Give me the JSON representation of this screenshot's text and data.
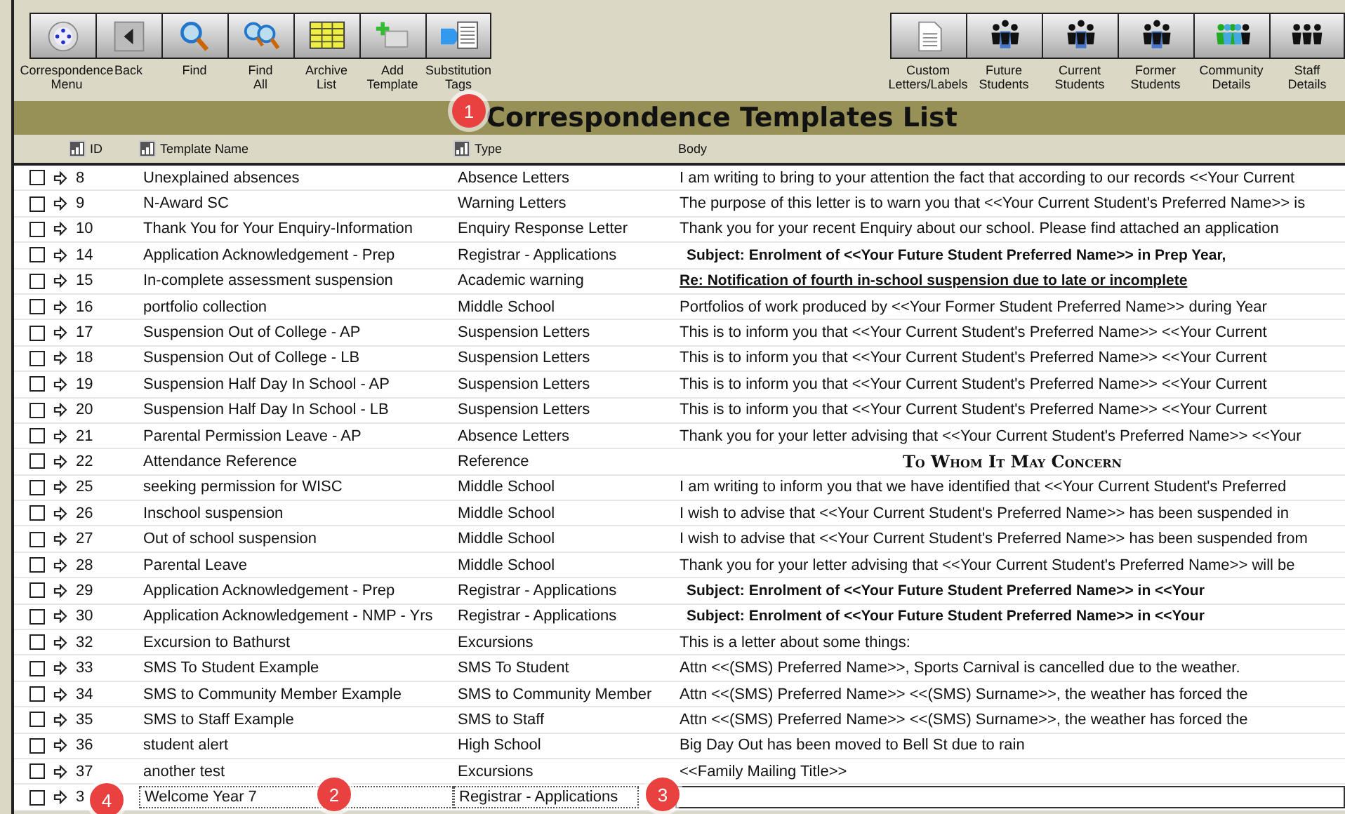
{
  "toolbar_left": [
    {
      "label": "Correspondence\nMenu"
    },
    {
      "label": "Back"
    },
    {
      "label": "Find"
    },
    {
      "label": "Find\nAll"
    },
    {
      "label": "Archive\nList"
    },
    {
      "label": "Add\nTemplate"
    },
    {
      "label": "Substitution\nTags"
    }
  ],
  "toolbar_right": [
    {
      "label": "Custom\nLetters/Labels"
    },
    {
      "label": "Future\nStudents"
    },
    {
      "label": "Current\nStudents"
    },
    {
      "label": "Former\nStudents"
    },
    {
      "label": "Community\nDetails"
    },
    {
      "label": "Staff\nDetails"
    }
  ],
  "title": "Correspondence Templates List",
  "table": {
    "columns": [
      {
        "label": "ID",
        "sortable": true
      },
      {
        "label": "Template Name",
        "sortable": true
      },
      {
        "label": "Type",
        "sortable": true
      },
      {
        "label": "Body",
        "sortable": false
      }
    ],
    "rows": [
      {
        "checked": false,
        "id": "8",
        "name": "Unexplained absences",
        "type": "Absence Letters",
        "body": "I am writing to bring to your attention the fact that according to our records <<Your Current",
        "kind": "plain"
      },
      {
        "checked": false,
        "id": "9",
        "name": "N-Award SC",
        "type": "Warning Letters",
        "body": "The purpose of this letter is to warn you that <<Your Current Student's Preferred Name>> is",
        "kind": "plain"
      },
      {
        "checked": false,
        "id": "10",
        "name": "Thank You for Your Enquiry-Information",
        "type": "Enquiry Response Letter",
        "body": "Thank you for your recent Enquiry about our school.  Please find attached an application",
        "kind": "plain"
      },
      {
        "checked": false,
        "id": "14",
        "name": "Application Acknowledgement - Prep",
        "type": "Registrar - Applications",
        "body": "Subject:  Enrolment of <<Your Future Student Preferred Name>> in Prep Year,",
        "kind": "bold"
      },
      {
        "checked": false,
        "id": "15",
        "name": "In-complete assessment suspension",
        "type": "Academic warning",
        "body": "Re: Notification of fourth in-school suspension due to late or incomplete",
        "kind": "underline"
      },
      {
        "checked": false,
        "id": "16",
        "name": "portfolio collection",
        "type": "Middle School",
        "body": "Portfolios of work produced by <<Your Former Student Preferred Name>> during Year",
        "kind": "plain"
      },
      {
        "checked": false,
        "id": "17",
        "name": "Suspension Out of College - AP",
        "type": "Suspension Letters",
        "body": "This is to inform you that <<Your Current Student's Preferred Name>> <<Your Current",
        "kind": "plain"
      },
      {
        "checked": false,
        "id": "18",
        "name": "Suspension Out of College - LB",
        "type": "Suspension Letters",
        "body": "This is to inform you that <<Your Current Student's Preferred Name>> <<Your Current",
        "kind": "plain"
      },
      {
        "checked": false,
        "id": "19",
        "name": "Suspension Half Day In School - AP",
        "type": "Suspension Letters",
        "body": "This is to inform you that <<Your Current Student's Preferred Name>> <<Your Current",
        "kind": "plain"
      },
      {
        "checked": false,
        "id": "20",
        "name": "Suspension Half Day In School - LB",
        "type": "Suspension Letters",
        "body": "This is to inform you that <<Your Current Student's Preferred Name>> <<Your Current",
        "kind": "plain"
      },
      {
        "checked": false,
        "id": "21",
        "name": "Parental Permission Leave - AP",
        "type": "Absence Letters",
        "body": "Thank you for your letter advising that <<Your Current Student's Preferred Name>> <<Your",
        "kind": "plain"
      },
      {
        "checked": false,
        "id": "22",
        "name": "Attendance Reference",
        "type": "Reference",
        "body": "To Whom It May Concern",
        "kind": "smallcaps"
      },
      {
        "checked": false,
        "id": "25",
        "name": "seeking permission for WISC",
        "type": "Middle School",
        "body": "I am writing to inform you that we have identified that <<Your Current Student's Preferred",
        "kind": "plain"
      },
      {
        "checked": false,
        "id": "26",
        "name": "Inschool suspension",
        "type": "Middle School",
        "body": "I wish to advise that <<Your Current Student's Preferred Name>> has been suspended in",
        "kind": "plain"
      },
      {
        "checked": false,
        "id": "27",
        "name": "Out of school suspension",
        "type": "Middle School",
        "body": "I wish to advise that <<Your Current Student's Preferred Name>> has been suspended from",
        "kind": "plain"
      },
      {
        "checked": false,
        "id": "28",
        "name": "Parental Leave",
        "type": "Middle School",
        "body": "Thank you for your letter advising that <<Your Current Student's Preferred Name>> will be",
        "kind": "plain"
      },
      {
        "checked": false,
        "id": "29",
        "name": "Application Acknowledgement - Prep",
        "type": "Registrar - Applications",
        "body": "Subject:  Enrolment of <<Your Future Student Preferred Name>> in <<Your",
        "kind": "bold"
      },
      {
        "checked": false,
        "id": "30",
        "name": "Application Acknowledgement - NMP - Yrs",
        "type": "Registrar - Applications",
        "body": "Subject:  Enrolment of <<Your Future Student Preferred Name>> in <<Your",
        "kind": "bold"
      },
      {
        "checked": false,
        "id": "32",
        "name": "Excursion to Bathurst",
        "type": "Excursions",
        "body": "This is a letter about some things:",
        "kind": "plain"
      },
      {
        "checked": false,
        "id": "33",
        "name": "SMS To Student Example",
        "type": "SMS To Student",
        "body": "Attn <<(SMS) Preferred Name>>, Sports Carnival is cancelled due to the weather.",
        "kind": "plain"
      },
      {
        "checked": false,
        "id": "34",
        "name": "SMS to Community Member Example",
        "type": "SMS to Community Member",
        "body": "Attn <<(SMS) Preferred Name>> <<(SMS) Surname>>, the weather has forced the",
        "kind": "plain"
      },
      {
        "checked": false,
        "id": "35",
        "name": "SMS to Staff Example",
        "type": "SMS to Staff",
        "body": "Attn <<(SMS) Preferred Name>> <<(SMS) Surname>>, the weather has forced the",
        "kind": "plain"
      },
      {
        "checked": false,
        "id": "36",
        "name": "student alert",
        "type": "High School",
        "body": "Big Day Out has been moved to Bell St due to rain",
        "kind": "plain"
      },
      {
        "checked": false,
        "id": "37",
        "name": "another test",
        "type": "Excursions",
        "body": "<<Family Mailing Title>>",
        "kind": "plain"
      },
      {
        "checked": false,
        "id": "3",
        "name": "Welcome Year 7",
        "type": "Registrar - Applications",
        "kind": "editing"
      }
    ]
  },
  "callouts": [
    "1",
    "4",
    "2",
    "3"
  ]
}
